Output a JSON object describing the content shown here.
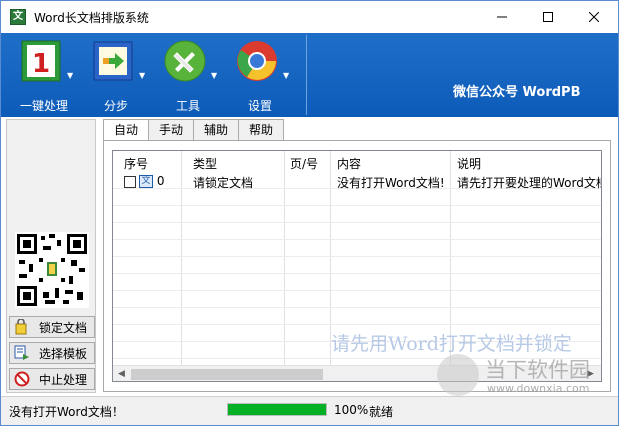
{
  "window": {
    "title": "Word长文档排版系统",
    "app_icon_glyph": "文",
    "controls": [
      "minimize-icon",
      "maximize-icon",
      "close-icon"
    ]
  },
  "toolbar": {
    "tools": [
      {
        "label": "一键处理",
        "icon": "one-key-icon"
      },
      {
        "label": "分步",
        "icon": "step-arrow-icon"
      },
      {
        "label": "工具",
        "icon": "tools-icon"
      },
      {
        "label": "设置",
        "icon": "settings-chrome-icon"
      }
    ],
    "brand": "微信公众号 WordPB",
    "colors": {
      "ribbon": "#1565c0"
    }
  },
  "sidebar": {
    "buttons": [
      {
        "label": "锁定文档",
        "icon": "lock-document-icon"
      },
      {
        "label": "选择模板",
        "icon": "select-template-icon"
      },
      {
        "label": "中止处理",
        "icon": "stop-icon"
      }
    ]
  },
  "tabs": [
    {
      "label": "自动",
      "active": true
    },
    {
      "label": "手动",
      "active": false
    },
    {
      "label": "辅助",
      "active": false
    },
    {
      "label": "帮助",
      "active": false
    }
  ],
  "grid": {
    "columns": [
      "序号",
      "类型",
      "页/号",
      "内容",
      "说明"
    ],
    "rows": [
      {
        "index": "0",
        "type": "请锁定文档",
        "page": "",
        "content": "没有打开Word文档!",
        "note": "请先打开要处理的Word文档"
      }
    ],
    "watermark": "请先用Word打开文档并锁定"
  },
  "status": {
    "message": "没有打开Word文档！",
    "progress_pct": 100,
    "progress_label": "100%",
    "state": "就绪",
    "progress_color": "#06b025"
  },
  "site_watermark": {
    "name": "当下软件园",
    "url": "www.downxia.com"
  }
}
